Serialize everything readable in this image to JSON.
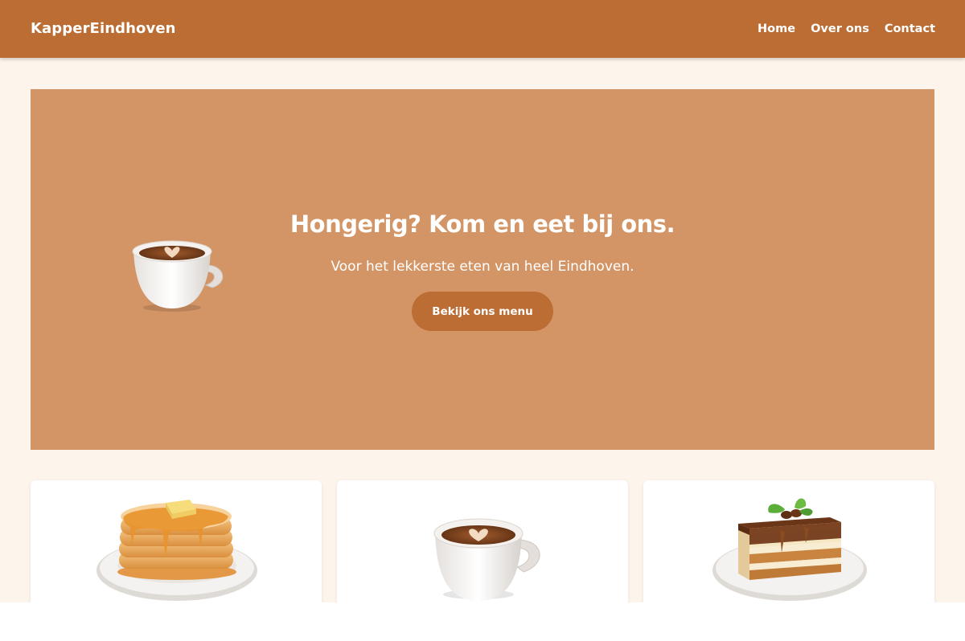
{
  "header": {
    "brand": "KapperEindhoven",
    "nav": [
      {
        "label": "Home"
      },
      {
        "label": "Over ons"
      },
      {
        "label": "Contact"
      }
    ]
  },
  "hero": {
    "title": "Hongerig? Kom en eet bij ons.",
    "subtitle": "Voor het lekkerste eten van heel Eindhoven.",
    "cta_label": "Bekijk ons menu",
    "icon": "coffee-cup-icon"
  },
  "cards": [
    {
      "icon": "pancakes-icon"
    },
    {
      "icon": "coffee-cup-icon"
    },
    {
      "icon": "tiramisu-cake-icon"
    }
  ],
  "colors": {
    "header": "#bb6d34",
    "hero": "#d49566",
    "background": "#fdf5ec",
    "button": "#bb6d34"
  }
}
